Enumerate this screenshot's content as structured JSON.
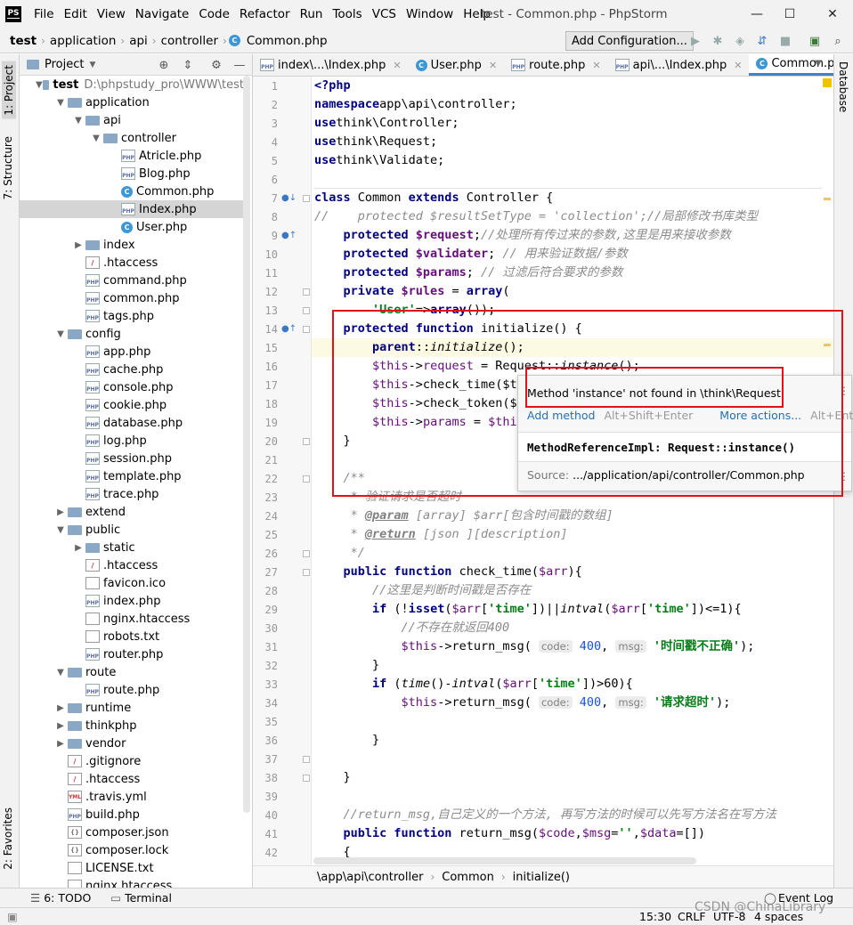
{
  "window": {
    "title": "test - Common.php - PhpStorm",
    "logo": "PS",
    "menu": [
      "File",
      "Edit",
      "View",
      "Navigate",
      "Code",
      "Refactor",
      "Run",
      "Tools",
      "VCS",
      "Window",
      "Help"
    ],
    "controls": {
      "minimize": "—",
      "maximize": "☐",
      "close": "✕"
    }
  },
  "navbar": {
    "breadcrumbs": [
      "test",
      "application",
      "api",
      "controller",
      "Common.php"
    ],
    "add_configuration": "Add Configuration..."
  },
  "side_tabs": {
    "left_top": [
      "1: Project",
      "7: Structure"
    ],
    "left_bottom": "2: Favorites",
    "right": "Database"
  },
  "project_panel": {
    "title": "Project",
    "tree": [
      {
        "depth": 0,
        "arrow": "▼",
        "icon": "folder",
        "name": "test",
        "path": "D:\\phpstudy_pro\\WWW\\test",
        "bold": true
      },
      {
        "depth": 1,
        "arrow": "▼",
        "icon": "folder",
        "name": "application"
      },
      {
        "depth": 2,
        "arrow": "▼",
        "icon": "folder",
        "name": "api"
      },
      {
        "depth": 3,
        "arrow": "▼",
        "icon": "folder",
        "name": "controller"
      },
      {
        "depth": 4,
        "arrow": "",
        "icon": "php",
        "name": "Atricle.php"
      },
      {
        "depth": 4,
        "arrow": "",
        "icon": "php",
        "name": "Blog.php"
      },
      {
        "depth": 4,
        "arrow": "",
        "icon": "class",
        "name": "Common.php"
      },
      {
        "depth": 4,
        "arrow": "",
        "icon": "php",
        "name": "Index.php",
        "selected": true
      },
      {
        "depth": 4,
        "arrow": "",
        "icon": "class",
        "name": "User.php"
      },
      {
        "depth": 2,
        "arrow": "▶",
        "icon": "folder",
        "name": "index"
      },
      {
        "depth": 2,
        "arrow": "",
        "icon": "git",
        "name": ".htaccess"
      },
      {
        "depth": 2,
        "arrow": "",
        "icon": "php",
        "name": "command.php"
      },
      {
        "depth": 2,
        "arrow": "",
        "icon": "php",
        "name": "common.php"
      },
      {
        "depth": 2,
        "arrow": "",
        "icon": "php",
        "name": "tags.php"
      },
      {
        "depth": 1,
        "arrow": "▼",
        "icon": "folder",
        "name": "config"
      },
      {
        "depth": 2,
        "arrow": "",
        "icon": "php",
        "name": "app.php"
      },
      {
        "depth": 2,
        "arrow": "",
        "icon": "php",
        "name": "cache.php"
      },
      {
        "depth": 2,
        "arrow": "",
        "icon": "php",
        "name": "console.php"
      },
      {
        "depth": 2,
        "arrow": "",
        "icon": "php",
        "name": "cookie.php"
      },
      {
        "depth": 2,
        "arrow": "",
        "icon": "php",
        "name": "database.php"
      },
      {
        "depth": 2,
        "arrow": "",
        "icon": "php",
        "name": "log.php"
      },
      {
        "depth": 2,
        "arrow": "",
        "icon": "php",
        "name": "session.php"
      },
      {
        "depth": 2,
        "arrow": "",
        "icon": "php",
        "name": "template.php"
      },
      {
        "depth": 2,
        "arrow": "",
        "icon": "php",
        "name": "trace.php"
      },
      {
        "depth": 1,
        "arrow": "▶",
        "icon": "folder",
        "name": "extend"
      },
      {
        "depth": 1,
        "arrow": "▼",
        "icon": "folder",
        "name": "public"
      },
      {
        "depth": 2,
        "arrow": "▶",
        "icon": "folder",
        "name": "static"
      },
      {
        "depth": 2,
        "arrow": "",
        "icon": "git",
        "name": ".htaccess"
      },
      {
        "depth": 2,
        "arrow": "",
        "icon": "file",
        "name": "favicon.ico"
      },
      {
        "depth": 2,
        "arrow": "",
        "icon": "php",
        "name": "index.php"
      },
      {
        "depth": 2,
        "arrow": "",
        "icon": "file",
        "name": "nginx.htaccess"
      },
      {
        "depth": 2,
        "arrow": "",
        "icon": "file",
        "name": "robots.txt"
      },
      {
        "depth": 2,
        "arrow": "",
        "icon": "php",
        "name": "router.php"
      },
      {
        "depth": 1,
        "arrow": "▼",
        "icon": "folder",
        "name": "route"
      },
      {
        "depth": 2,
        "arrow": "",
        "icon": "php",
        "name": "route.php"
      },
      {
        "depth": 1,
        "arrow": "▶",
        "icon": "folder",
        "name": "runtime"
      },
      {
        "depth": 1,
        "arrow": "▶",
        "icon": "folder",
        "name": "thinkphp"
      },
      {
        "depth": 1,
        "arrow": "▶",
        "icon": "folder",
        "name": "vendor"
      },
      {
        "depth": 1,
        "arrow": "",
        "icon": "git",
        "name": ".gitignore"
      },
      {
        "depth": 1,
        "arrow": "",
        "icon": "git",
        "name": ".htaccess"
      },
      {
        "depth": 1,
        "arrow": "",
        "icon": "yml",
        "name": ".travis.yml"
      },
      {
        "depth": 1,
        "arrow": "",
        "icon": "php",
        "name": "build.php"
      },
      {
        "depth": 1,
        "arrow": "",
        "icon": "json",
        "name": "composer.json"
      },
      {
        "depth": 1,
        "arrow": "",
        "icon": "json",
        "name": "composer.lock"
      },
      {
        "depth": 1,
        "arrow": "",
        "icon": "file",
        "name": "LICENSE.txt"
      },
      {
        "depth": 1,
        "arrow": "",
        "icon": "file",
        "name": "nginx.htaccess"
      }
    ]
  },
  "editor_tabs": [
    {
      "label": "index\\...\\Index.php",
      "icon": "php",
      "active": false
    },
    {
      "label": "User.php",
      "icon": "class",
      "active": false
    },
    {
      "label": "route.php",
      "icon": "php",
      "active": false
    },
    {
      "label": "api\\...\\Index.php",
      "icon": "php",
      "active": false
    },
    {
      "label": "Common.php",
      "icon": "class",
      "active": true
    }
  ],
  "editor": {
    "line_numbers": [
      "1",
      "2",
      "3",
      "4",
      "5",
      "6",
      "7",
      "8",
      "9",
      "10",
      "11",
      "12",
      "13",
      "14",
      "15",
      "16",
      "17",
      "18",
      "19",
      "20",
      "21",
      "22",
      "23",
      "24",
      "25",
      "26",
      "27",
      "28",
      "29",
      "30",
      "31",
      "32",
      "33",
      "34",
      "35",
      "36",
      "37",
      "38",
      "39",
      "40",
      "41",
      "42"
    ],
    "current_line": 15,
    "lines": [
      [
        [
          "kw",
          "<?php"
        ]
      ],
      [
        [
          "kw",
          "namespace"
        ],
        [
          "",
          "app\\api\\controller;"
        ]
      ],
      [
        [
          "kw",
          "use"
        ],
        [
          "",
          "think\\Controller;"
        ]
      ],
      [
        [
          "kw",
          "use"
        ],
        [
          "",
          "think\\Request;"
        ]
      ],
      [
        [
          "kw",
          "use"
        ],
        [
          "",
          "think\\Validate;"
        ]
      ],
      [],
      [
        [
          "kw",
          "class"
        ],
        [
          "",
          " Common "
        ],
        [
          "kw",
          "extends"
        ],
        [
          "",
          " Controller {"
        ]
      ],
      [
        [
          "cmt",
          "//    protected $resultSetType = 'collection';//局部修改书库类型"
        ]
      ],
      [
        [
          "",
          "    "
        ],
        [
          "kw",
          "protected"
        ],
        [
          "var-b",
          " $request"
        ],
        [
          "",
          ";"
        ],
        [
          "cmt",
          "//处理所有传过来的参数,这里是用来接收参数"
        ]
      ],
      [
        [
          "",
          "    "
        ],
        [
          "kw",
          "protected"
        ],
        [
          "var-b",
          " $validater"
        ],
        [
          "",
          "; "
        ],
        [
          "cmt",
          "// 用来验证数据/参数"
        ]
      ],
      [
        [
          "",
          "    "
        ],
        [
          "kw",
          "protected"
        ],
        [
          "var-b",
          " $params"
        ],
        [
          "",
          "; "
        ],
        [
          "cmt",
          "// 过滤后符合要求的参数"
        ]
      ],
      [
        [
          "",
          "    "
        ],
        [
          "kw",
          "private"
        ],
        [
          "var-b",
          " $rules"
        ],
        [
          "",
          " = "
        ],
        [
          "kw",
          "array"
        ],
        [
          "",
          "("
        ]
      ],
      [
        [
          "",
          "        "
        ],
        [
          "str",
          "'User'"
        ],
        [
          "",
          "=>"
        ],
        [
          "kw",
          "array"
        ],
        [
          "",
          "());"
        ]
      ],
      [
        [
          "",
          "    "
        ],
        [
          "kw",
          "protected function"
        ],
        [
          "",
          " initialize() {"
        ]
      ],
      [
        [
          "",
          "        "
        ],
        [
          "kw",
          "parent"
        ],
        [
          "",
          "::"
        ],
        [
          "fn-i",
          "initialize"
        ],
        [
          "",
          "();"
        ]
      ],
      [
        [
          "",
          "        "
        ],
        [
          "var",
          "$this"
        ],
        [
          "",
          "->"
        ],
        [
          "var",
          "request"
        ],
        [
          "",
          " = Request::"
        ],
        [
          "fn-i",
          "instance"
        ],
        [
          "",
          "();"
        ]
      ],
      [
        [
          "",
          "        "
        ],
        [
          "var",
          "$this"
        ],
        [
          "",
          "->check_time($th"
        ]
      ],
      [
        [
          "",
          "        "
        ],
        [
          "var",
          "$this"
        ],
        [
          "",
          "->check_token($t"
        ]
      ],
      [
        [
          "",
          "        "
        ],
        [
          "var",
          "$this"
        ],
        [
          "",
          "->"
        ],
        [
          "var",
          "params"
        ],
        [
          "",
          " = "
        ],
        [
          "var",
          "$this"
        ]
      ],
      [
        [
          "",
          "    }"
        ]
      ],
      [],
      [
        [
          "",
          "    "
        ],
        [
          "cmt",
          "/**"
        ]
      ],
      [
        [
          "",
          "     "
        ],
        [
          "cmt",
          "* 验证请求是否超时"
        ]
      ],
      [
        [
          "",
          "     "
        ],
        [
          "cmt",
          "* "
        ],
        [
          "doc-tag",
          "@param"
        ],
        [
          "cmt",
          " [array] $arr[包含时间戳的数组]"
        ]
      ],
      [
        [
          "",
          "     "
        ],
        [
          "cmt",
          "* "
        ],
        [
          "doc-tag",
          "@return"
        ],
        [
          "cmt",
          " [json ][description]"
        ]
      ],
      [
        [
          "",
          "     "
        ],
        [
          "cmt",
          "*/"
        ]
      ],
      [
        [
          "",
          "    "
        ],
        [
          "kw",
          "public function"
        ],
        [
          "",
          " check_time("
        ],
        [
          "var",
          "$arr"
        ],
        [
          "",
          "){"
        ]
      ],
      [
        [
          "",
          "        "
        ],
        [
          "cmt",
          "//这里是判断时间戳是否存在"
        ]
      ],
      [
        [
          "",
          "        "
        ],
        [
          "kw",
          "if"
        ],
        [
          "",
          " (!"
        ],
        [
          "kw",
          "isset"
        ],
        [
          "",
          "("
        ],
        [
          "var",
          "$arr"
        ],
        [
          "",
          "["
        ],
        [
          "str",
          "'time'"
        ],
        [
          "",
          "])||"
        ],
        [
          "fn-i",
          "intval"
        ],
        [
          "",
          "("
        ],
        [
          "var",
          "$arr"
        ],
        [
          "",
          "["
        ],
        [
          "str",
          "'time'"
        ],
        [
          "",
          "])<=1){"
        ]
      ],
      [
        [
          "",
          "            "
        ],
        [
          "cmt",
          "//不存在就返回400"
        ]
      ],
      [
        [
          "",
          "            "
        ],
        [
          "var",
          "$this"
        ],
        [
          "",
          "->return_msg( "
        ],
        [
          "hint",
          "code:"
        ],
        [
          "",
          " "
        ],
        [
          "num",
          "400"
        ],
        [
          "",
          ", "
        ],
        [
          "hint",
          "msg:"
        ],
        [
          "",
          " "
        ],
        [
          "str",
          "'时间戳不正确'"
        ],
        [
          "",
          ");"
        ]
      ],
      [
        [
          "",
          "        }"
        ]
      ],
      [
        [
          "",
          "        "
        ],
        [
          "kw",
          "if"
        ],
        [
          "",
          " ("
        ],
        [
          "fn-i",
          "time"
        ],
        [
          "",
          "()-"
        ],
        [
          "fn-i",
          "intval"
        ],
        [
          "",
          "("
        ],
        [
          "var",
          "$arr"
        ],
        [
          "",
          "["
        ],
        [
          "str",
          "'time'"
        ],
        [
          "",
          "])>60){"
        ]
      ],
      [
        [
          "",
          "            "
        ],
        [
          "var",
          "$this"
        ],
        [
          "",
          "->return_msg( "
        ],
        [
          "hint",
          "code:"
        ],
        [
          "",
          " "
        ],
        [
          "num",
          "400"
        ],
        [
          "",
          ", "
        ],
        [
          "hint",
          "msg:"
        ],
        [
          "",
          " "
        ],
        [
          "str",
          "'请求超时'"
        ],
        [
          "",
          ");"
        ]
      ],
      [],
      [
        [
          "",
          "        }"
        ]
      ],
      [],
      [
        [
          "",
          "    }"
        ]
      ],
      [],
      [
        [
          "",
          "    "
        ],
        [
          "cmt",
          "//return_msg,自己定义的一个方法, 再写方法的时候可以先写方法名在写方法"
        ]
      ],
      [
        [
          "",
          "    "
        ],
        [
          "kw",
          "public function"
        ],
        [
          "",
          " return_msg("
        ],
        [
          "var",
          "$code"
        ],
        [
          "",
          ","
        ],
        [
          "var",
          "$msg"
        ],
        [
          "",
          "="
        ],
        [
          "str",
          "''"
        ],
        [
          "",
          ","
        ],
        [
          "var",
          "$data"
        ],
        [
          "",
          "=[])"
        ]
      ],
      [
        [
          "",
          "    {"
        ]
      ]
    ]
  },
  "popup": {
    "message": "Method 'instance' not found in \\think\\Request",
    "add_method": "Add method",
    "add_method_shortcut": "Alt+Shift+Enter",
    "more_actions": "More actions...",
    "more_actions_shortcut": "Alt+Enter",
    "signature": "MethodReferenceImpl: Request::instance()",
    "source_label": "Source:",
    "source_path": ".../application/api/controller/Common.php"
  },
  "editor_breadcrumb": [
    "\\app\\api\\controller",
    "Common",
    "initialize()"
  ],
  "bottom_tools": {
    "todo": "6: TODO",
    "terminal": "Terminal",
    "event_log": "Event Log"
  },
  "status": {
    "position": "15:30",
    "line_sep": "CRLF",
    "encoding": "UTF-8",
    "indent": "4 spaces"
  },
  "watermark": "CSDN @ChinaLibrary"
}
